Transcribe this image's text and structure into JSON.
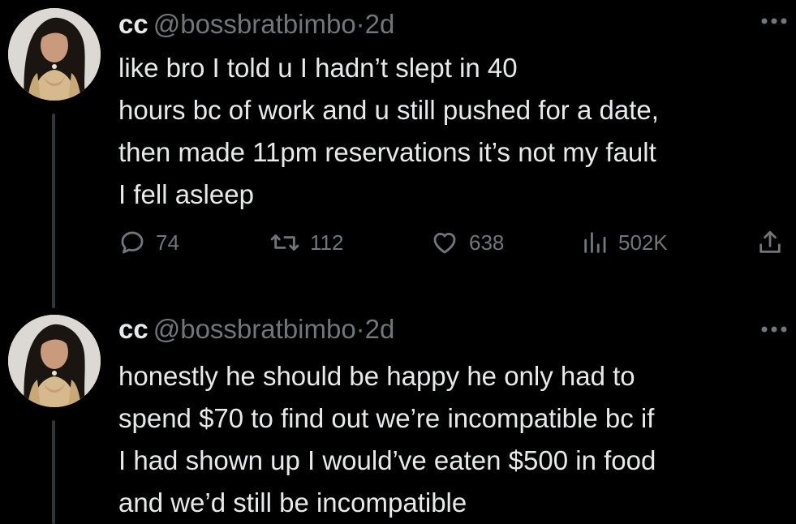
{
  "tweets": [
    {
      "display_name": "cc",
      "handle": "@bossbratbimbo",
      "separator": "·",
      "time": "2d",
      "more_icon": "more-horizontal-icon",
      "text": "like bro I told u I hadn’t slept in 40\nhours bc of work and u still pushed for a date,\nthen made 11pm reservations it’s not my fault\nI fell asleep",
      "actions": {
        "replies": "74",
        "reposts": "112",
        "likes": "638",
        "views": "502K"
      }
    },
    {
      "display_name": "cc",
      "handle": "@bossbratbimbo",
      "separator": "·",
      "time": "2d",
      "more_icon": "more-horizontal-icon",
      "text": "honestly he should be happy he only had to\nspend $70 to find out we’re incompatible bc if\nI had shown up I would’ve eaten $500 in food\nand we’d still be incompatible"
    }
  ],
  "colors": {
    "background": "#000000",
    "text_primary": "#e7e9ea",
    "text_secondary": "#71767b",
    "thread_line": "#333639"
  }
}
